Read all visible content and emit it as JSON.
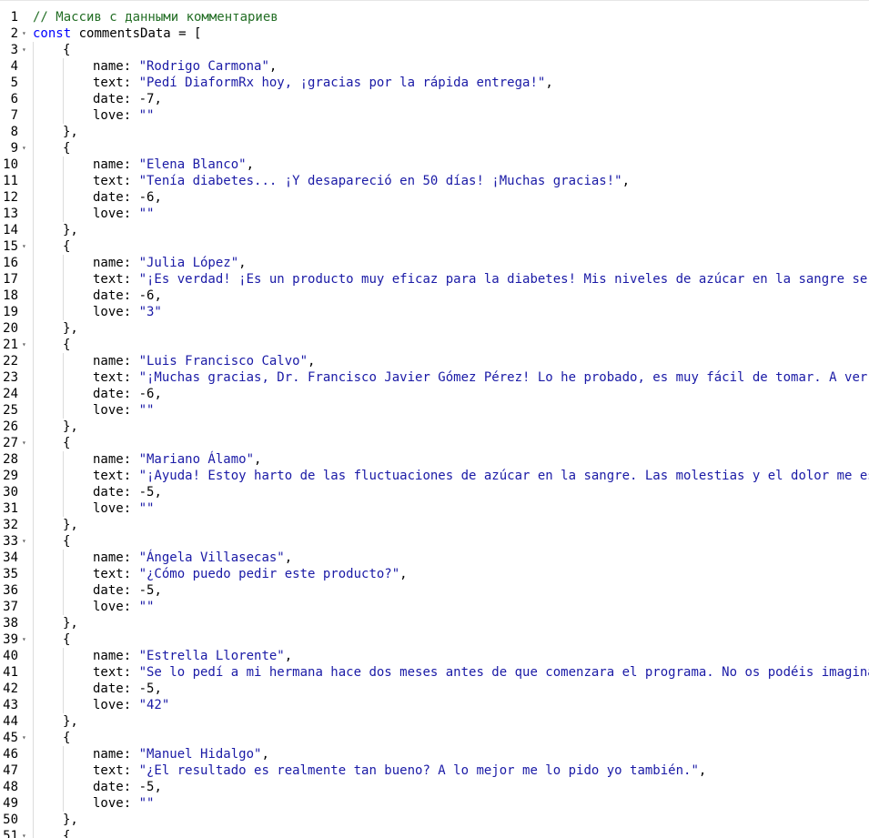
{
  "editor": {
    "language": "javascript",
    "fold_icon": "chevron-down-icon",
    "lines": [
      {
        "n": "1",
        "indent": 0,
        "fold": false,
        "tokens": [
          {
            "t": "// Массив с данными комментариев",
            "c": "comment"
          }
        ]
      },
      {
        "n": "2",
        "indent": 0,
        "fold": true,
        "tokens": [
          {
            "t": "const",
            "c": "keyword"
          },
          {
            "t": " commentsData = [",
            "c": ""
          }
        ]
      },
      {
        "n": "3",
        "indent": 1,
        "fold": true,
        "tokens": [
          {
            "t": "{",
            "c": ""
          }
        ]
      },
      {
        "n": "4",
        "indent": 2,
        "fold": false,
        "tokens": [
          {
            "t": "name: ",
            "c": ""
          },
          {
            "t": "\"Rodrigo Carmona\"",
            "c": "string"
          },
          {
            "t": ",",
            "c": ""
          }
        ]
      },
      {
        "n": "5",
        "indent": 2,
        "fold": false,
        "tokens": [
          {
            "t": "text: ",
            "c": ""
          },
          {
            "t": "\"Pedí DiaformRx hoy, ¡gracias por la rápida entrega!\"",
            "c": "string"
          },
          {
            "t": ",",
            "c": ""
          }
        ]
      },
      {
        "n": "6",
        "indent": 2,
        "fold": false,
        "tokens": [
          {
            "t": "date: ",
            "c": ""
          },
          {
            "t": "-7",
            "c": "num"
          },
          {
            "t": ",",
            "c": ""
          }
        ]
      },
      {
        "n": "7",
        "indent": 2,
        "fold": false,
        "tokens": [
          {
            "t": "love: ",
            "c": ""
          },
          {
            "t": "\"\"",
            "c": "string"
          }
        ]
      },
      {
        "n": "8",
        "indent": 1,
        "fold": false,
        "tokens": [
          {
            "t": "},",
            "c": ""
          }
        ]
      },
      {
        "n": "9",
        "indent": 1,
        "fold": true,
        "tokens": [
          {
            "t": "{",
            "c": ""
          }
        ]
      },
      {
        "n": "10",
        "indent": 2,
        "fold": false,
        "tokens": [
          {
            "t": "name: ",
            "c": ""
          },
          {
            "t": "\"Elena Blanco\"",
            "c": "string"
          },
          {
            "t": ",",
            "c": ""
          }
        ]
      },
      {
        "n": "11",
        "indent": 2,
        "fold": false,
        "tokens": [
          {
            "t": "text: ",
            "c": ""
          },
          {
            "t": "\"Tenía diabetes... ¡Y desapareció en 50 días! ¡Muchas gracias!\"",
            "c": "string"
          },
          {
            "t": ",",
            "c": ""
          }
        ]
      },
      {
        "n": "12",
        "indent": 2,
        "fold": false,
        "tokens": [
          {
            "t": "date: ",
            "c": ""
          },
          {
            "t": "-6",
            "c": "num"
          },
          {
            "t": ",",
            "c": ""
          }
        ]
      },
      {
        "n": "13",
        "indent": 2,
        "fold": false,
        "tokens": [
          {
            "t": "love: ",
            "c": ""
          },
          {
            "t": "\"\"",
            "c": "string"
          }
        ]
      },
      {
        "n": "14",
        "indent": 1,
        "fold": false,
        "tokens": [
          {
            "t": "},",
            "c": ""
          }
        ]
      },
      {
        "n": "15",
        "indent": 1,
        "fold": true,
        "tokens": [
          {
            "t": "{",
            "c": ""
          }
        ]
      },
      {
        "n": "16",
        "indent": 2,
        "fold": false,
        "tokens": [
          {
            "t": "name: ",
            "c": ""
          },
          {
            "t": "\"Julia López\"",
            "c": "string"
          },
          {
            "t": ",",
            "c": ""
          }
        ]
      },
      {
        "n": "17",
        "indent": 2,
        "fold": false,
        "tokens": [
          {
            "t": "text: ",
            "c": ""
          },
          {
            "t": "\"¡Es verdad! ¡Es un producto muy eficaz para la diabetes! Mis niveles de azúcar en la sangre se ha",
            "c": "string"
          }
        ]
      },
      {
        "n": "18",
        "indent": 2,
        "fold": false,
        "tokens": [
          {
            "t": "date: ",
            "c": ""
          },
          {
            "t": "-6",
            "c": "num"
          },
          {
            "t": ",",
            "c": ""
          }
        ]
      },
      {
        "n": "19",
        "indent": 2,
        "fold": false,
        "tokens": [
          {
            "t": "love: ",
            "c": ""
          },
          {
            "t": "\"3\"",
            "c": "string"
          }
        ]
      },
      {
        "n": "20",
        "indent": 1,
        "fold": false,
        "tokens": [
          {
            "t": "},",
            "c": ""
          }
        ]
      },
      {
        "n": "21",
        "indent": 1,
        "fold": true,
        "tokens": [
          {
            "t": "{",
            "c": ""
          }
        ]
      },
      {
        "n": "22",
        "indent": 2,
        "fold": false,
        "tokens": [
          {
            "t": "name: ",
            "c": ""
          },
          {
            "t": "\"Luis Francisco Calvo\"",
            "c": "string"
          },
          {
            "t": ",",
            "c": ""
          }
        ]
      },
      {
        "n": "23",
        "indent": 2,
        "fold": false,
        "tokens": [
          {
            "t": "text: ",
            "c": ""
          },
          {
            "t": "\"¡Muchas gracias, Dr. Francisco Javier Gómez Pérez! Lo he probado, es muy fácil de tomar. A ver qu",
            "c": "string"
          }
        ]
      },
      {
        "n": "24",
        "indent": 2,
        "fold": false,
        "tokens": [
          {
            "t": "date: ",
            "c": ""
          },
          {
            "t": "-6",
            "c": "num"
          },
          {
            "t": ",",
            "c": ""
          }
        ]
      },
      {
        "n": "25",
        "indent": 2,
        "fold": false,
        "tokens": [
          {
            "t": "love: ",
            "c": ""
          },
          {
            "t": "\"\"",
            "c": "string"
          }
        ]
      },
      {
        "n": "26",
        "indent": 1,
        "fold": false,
        "tokens": [
          {
            "t": "},",
            "c": ""
          }
        ]
      },
      {
        "n": "27",
        "indent": 1,
        "fold": true,
        "tokens": [
          {
            "t": "{",
            "c": ""
          }
        ]
      },
      {
        "n": "28",
        "indent": 2,
        "fold": false,
        "tokens": [
          {
            "t": "name: ",
            "c": ""
          },
          {
            "t": "\"Mariano Álamo\"",
            "c": "string"
          },
          {
            "t": ",",
            "c": ""
          }
        ]
      },
      {
        "n": "29",
        "indent": 2,
        "fold": false,
        "tokens": [
          {
            "t": "text: ",
            "c": ""
          },
          {
            "t": "\"¡Ayuda! Estoy harto de las fluctuaciones de azúcar en la sangre. Las molestias y el dolor me esta",
            "c": "string"
          }
        ]
      },
      {
        "n": "30",
        "indent": 2,
        "fold": false,
        "tokens": [
          {
            "t": "date: ",
            "c": ""
          },
          {
            "t": "-5",
            "c": "num"
          },
          {
            "t": ",",
            "c": ""
          }
        ]
      },
      {
        "n": "31",
        "indent": 2,
        "fold": false,
        "tokens": [
          {
            "t": "love: ",
            "c": ""
          },
          {
            "t": "\"\"",
            "c": "string"
          }
        ]
      },
      {
        "n": "32",
        "indent": 1,
        "fold": false,
        "tokens": [
          {
            "t": "},",
            "c": ""
          }
        ]
      },
      {
        "n": "33",
        "indent": 1,
        "fold": true,
        "tokens": [
          {
            "t": "{",
            "c": ""
          }
        ]
      },
      {
        "n": "34",
        "indent": 2,
        "fold": false,
        "tokens": [
          {
            "t": "name: ",
            "c": ""
          },
          {
            "t": "\"Ángela Villasecas\"",
            "c": "string"
          },
          {
            "t": ",",
            "c": ""
          }
        ]
      },
      {
        "n": "35",
        "indent": 2,
        "fold": false,
        "tokens": [
          {
            "t": "text: ",
            "c": ""
          },
          {
            "t": "\"¿Cómo puedo pedir este producto?\"",
            "c": "string"
          },
          {
            "t": ",",
            "c": ""
          }
        ]
      },
      {
        "n": "36",
        "indent": 2,
        "fold": false,
        "tokens": [
          {
            "t": "date: ",
            "c": ""
          },
          {
            "t": "-5",
            "c": "num"
          },
          {
            "t": ",",
            "c": ""
          }
        ]
      },
      {
        "n": "37",
        "indent": 2,
        "fold": false,
        "tokens": [
          {
            "t": "love: ",
            "c": ""
          },
          {
            "t": "\"\"",
            "c": "string"
          }
        ]
      },
      {
        "n": "38",
        "indent": 1,
        "fold": false,
        "tokens": [
          {
            "t": "},",
            "c": ""
          }
        ]
      },
      {
        "n": "39",
        "indent": 1,
        "fold": true,
        "tokens": [
          {
            "t": "{",
            "c": ""
          }
        ]
      },
      {
        "n": "40",
        "indent": 2,
        "fold": false,
        "tokens": [
          {
            "t": "name: ",
            "c": ""
          },
          {
            "t": "\"Estrella Llorente\"",
            "c": "string"
          },
          {
            "t": ",",
            "c": ""
          }
        ]
      },
      {
        "n": "41",
        "indent": 2,
        "fold": false,
        "tokens": [
          {
            "t": "text: ",
            "c": ""
          },
          {
            "t": "\"Se lo pedí a mi hermana hace dos meses antes de que comenzara el programa. No os podéis imaginar",
            "c": "string"
          }
        ]
      },
      {
        "n": "42",
        "indent": 2,
        "fold": false,
        "tokens": [
          {
            "t": "date: ",
            "c": ""
          },
          {
            "t": "-5",
            "c": "num"
          },
          {
            "t": ",",
            "c": ""
          }
        ]
      },
      {
        "n": "43",
        "indent": 2,
        "fold": false,
        "tokens": [
          {
            "t": "love: ",
            "c": ""
          },
          {
            "t": "\"42\"",
            "c": "string"
          }
        ]
      },
      {
        "n": "44",
        "indent": 1,
        "fold": false,
        "tokens": [
          {
            "t": "},",
            "c": ""
          }
        ]
      },
      {
        "n": "45",
        "indent": 1,
        "fold": true,
        "tokens": [
          {
            "t": "{",
            "c": ""
          }
        ]
      },
      {
        "n": "46",
        "indent": 2,
        "fold": false,
        "tokens": [
          {
            "t": "name: ",
            "c": ""
          },
          {
            "t": "\"Manuel Hidalgo\"",
            "c": "string"
          },
          {
            "t": ",",
            "c": ""
          }
        ]
      },
      {
        "n": "47",
        "indent": 2,
        "fold": false,
        "tokens": [
          {
            "t": "text: ",
            "c": ""
          },
          {
            "t": "\"¿El resultado es realmente tan bueno? A lo mejor me lo pido yo también.\"",
            "c": "string"
          },
          {
            "t": ",",
            "c": ""
          }
        ]
      },
      {
        "n": "48",
        "indent": 2,
        "fold": false,
        "tokens": [
          {
            "t": "date: ",
            "c": ""
          },
          {
            "t": "-5",
            "c": "num"
          },
          {
            "t": ",",
            "c": ""
          }
        ]
      },
      {
        "n": "49",
        "indent": 2,
        "fold": false,
        "tokens": [
          {
            "t": "love: ",
            "c": ""
          },
          {
            "t": "\"\"",
            "c": "string"
          }
        ]
      },
      {
        "n": "50",
        "indent": 1,
        "fold": false,
        "tokens": [
          {
            "t": "},",
            "c": ""
          }
        ]
      },
      {
        "n": "51",
        "indent": 1,
        "fold": true,
        "tokens": [
          {
            "t": "{",
            "c": ""
          }
        ]
      }
    ]
  },
  "colors": {
    "comment": "#236e25",
    "keyword": "#0000ff",
    "string": "#1a1aa6",
    "default": "#000000",
    "indent_guide": "#dcdcdc"
  }
}
